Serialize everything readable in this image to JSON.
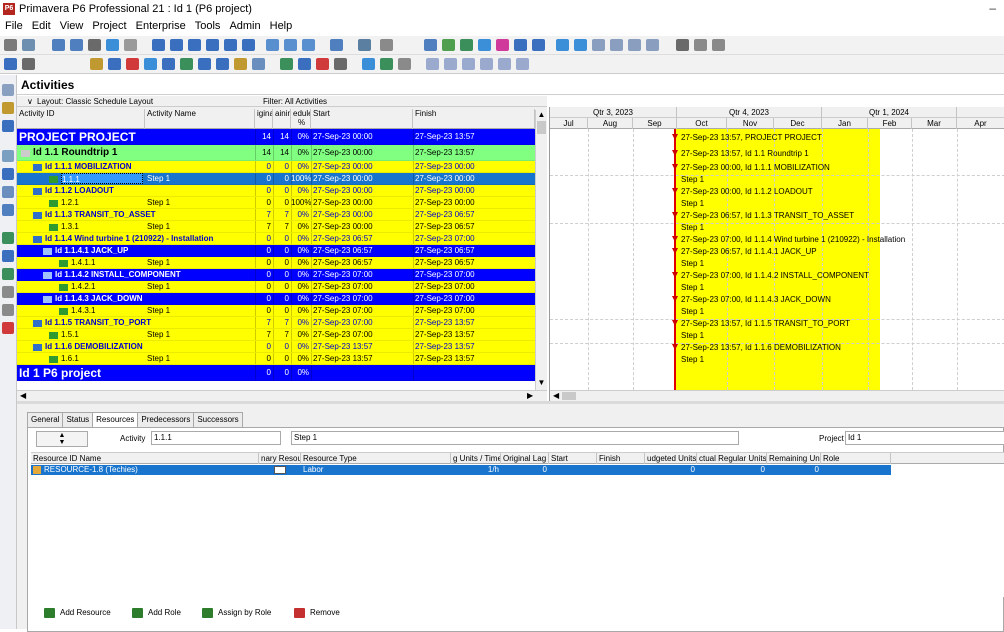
{
  "app": {
    "title": "Primavera P6 Professional 21 : Id 1 (P6 project)",
    "icon_text": "P6",
    "minimize_glyph": "–"
  },
  "menu": [
    "File",
    "Edit",
    "View",
    "Project",
    "Enterprise",
    "Tools",
    "Admin",
    "Help"
  ],
  "panel_title": "Activities",
  "layout_label": "Layout: Classic Schedule Layout",
  "filter_label": "Filter: All Activities",
  "columns": {
    "id": "Activity ID",
    "name": "Activity Name",
    "orig": "iginal",
    "rem": "aining",
    "sched_1": "edule",
    "sched_2": "%",
    "start": "Start",
    "finish": "Finish"
  },
  "rows": [
    {
      "kind": "project",
      "id": "PROJECT  PROJECT",
      "name": "",
      "orig": "14",
      "rem": "14",
      "pct": "0%",
      "start": "27-Sep-23 00:00",
      "finish": "27-Sep-23 13:57"
    },
    {
      "kind": "l1",
      "id": "Id 1.1  Roundtrip 1",
      "name": "",
      "orig": "14",
      "rem": "14",
      "pct": "0%",
      "start": "27-Sep-23 00:00",
      "finish": "27-Sep-23 13:57"
    },
    {
      "kind": "wbs",
      "id": "Id 1.1.1  MOBILIZATION",
      "name": "",
      "orig": "0",
      "rem": "0",
      "pct": "0%",
      "start": "27-Sep-23 00:00",
      "finish": "27-Sep-23 00:00"
    },
    {
      "kind": "sel",
      "id": "1.1.1",
      "name": "Step 1",
      "orig": "0",
      "rem": "0",
      "pct": "100%",
      "start": "27-Sep-23 00:00",
      "finish": "27-Sep-23 00:00"
    },
    {
      "kind": "wbs",
      "id": "Id 1.1.2  LOADOUT",
      "name": "",
      "orig": "0",
      "rem": "0",
      "pct": "0%",
      "start": "27-Sep-23 00:00",
      "finish": "27-Sep-23 00:00"
    },
    {
      "kind": "act",
      "id": "1.2.1",
      "name": "Step 1",
      "orig": "0",
      "rem": "0",
      "pct": "100%",
      "start": "27-Sep-23 00:00",
      "finish": "27-Sep-23 00:00"
    },
    {
      "kind": "wbs",
      "id": "Id 1.1.3  TRANSIT_TO_ASSET",
      "name": "",
      "orig": "7",
      "rem": "7",
      "pct": "0%",
      "start": "27-Sep-23 00:00",
      "finish": "27-Sep-23 06:57"
    },
    {
      "kind": "act",
      "id": "1.3.1",
      "name": "Step 1",
      "orig": "7",
      "rem": "7",
      "pct": "0%",
      "start": "27-Sep-23 00:00",
      "finish": "27-Sep-23 06:57"
    },
    {
      "kind": "wbs",
      "id": "Id 1.1.4  Wind turbine 1 (210922) - Installation",
      "name": "",
      "orig": "0",
      "rem": "0",
      "pct": "0%",
      "start": "27-Sep-23 06:57",
      "finish": "27-Sep-23 07:00"
    },
    {
      "kind": "sub",
      "id": "Id 1.1.4.1  JACK_UP",
      "name": "",
      "orig": "0",
      "rem": "0",
      "pct": "0%",
      "start": "27-Sep-23 06:57",
      "finish": "27-Sep-23 06:57"
    },
    {
      "kind": "act2",
      "id": "1.4.1.1",
      "name": "Step 1",
      "orig": "0",
      "rem": "0",
      "pct": "0%",
      "start": "27-Sep-23 06:57",
      "finish": "27-Sep-23 06:57"
    },
    {
      "kind": "sub",
      "id": "Id 1.1.4.2  INSTALL_COMPONENT",
      "name": "",
      "orig": "0",
      "rem": "0",
      "pct": "0%",
      "start": "27-Sep-23 07:00",
      "finish": "27-Sep-23 07:00"
    },
    {
      "kind": "act2",
      "id": "1.4.2.1",
      "name": "Step 1",
      "orig": "0",
      "rem": "0",
      "pct": "0%",
      "start": "27-Sep-23 07:00",
      "finish": "27-Sep-23 07:00"
    },
    {
      "kind": "sub",
      "id": "Id 1.1.4.3  JACK_DOWN",
      "name": "",
      "orig": "0",
      "rem": "0",
      "pct": "0%",
      "start": "27-Sep-23 07:00",
      "finish": "27-Sep-23 07:00"
    },
    {
      "kind": "act2",
      "id": "1.4.3.1",
      "name": "Step 1",
      "orig": "0",
      "rem": "0",
      "pct": "0%",
      "start": "27-Sep-23 07:00",
      "finish": "27-Sep-23 07:00"
    },
    {
      "kind": "wbs",
      "id": "Id 1.1.5  TRANSIT_TO_PORT",
      "name": "",
      "orig": "7",
      "rem": "7",
      "pct": "0%",
      "start": "27-Sep-23 07:00",
      "finish": "27-Sep-23 13:57"
    },
    {
      "kind": "act",
      "id": "1.5.1",
      "name": "Step 1",
      "orig": "7",
      "rem": "7",
      "pct": "0%",
      "start": "27-Sep-23 07:00",
      "finish": "27-Sep-23 13:57"
    },
    {
      "kind": "wbs",
      "id": "Id 1.1.6  DEMOBILIZATION",
      "name": "",
      "orig": "0",
      "rem": "0",
      "pct": "0%",
      "start": "27-Sep-23 13:57",
      "finish": "27-Sep-23 13:57"
    },
    {
      "kind": "act",
      "id": "1.6.1",
      "name": "Step 1",
      "orig": "0",
      "rem": "0",
      "pct": "0%",
      "start": "27-Sep-23 13:57",
      "finish": "27-Sep-23 13:57"
    },
    {
      "kind": "project",
      "id": "Id 1  P6 project",
      "name": "",
      "orig": "0",
      "rem": "0",
      "pct": "0%",
      "start": "",
      "finish": ""
    }
  ],
  "timeline": {
    "quarters": [
      "Qtr 3, 2023",
      "Qtr 4, 2023",
      "Qtr 1, 2024"
    ],
    "months": [
      "Jul",
      "Aug",
      "Sep",
      "Oct",
      "Nov",
      "Dec",
      "Jan",
      "Feb",
      "Mar",
      "Apr"
    ]
  },
  "gantt_labels": [
    "27-Sep-23 13:57, PROJECT  PROJECT",
    "27-Sep-23 13:57, Id 1.1  Roundtrip 1",
    "27-Sep-23 00:00, Id 1.1.1  MOBILIZATION",
    "Step 1",
    "27-Sep-23 00:00, Id 1.1.2  LOADOUT",
    "Step 1",
    "27-Sep-23 06:57, Id 1.1.3  TRANSIT_TO_ASSET",
    "Step 1",
    "27-Sep-23 07:00, Id 1.1.4  Wind turbine 1 (210922) - Installation",
    "27-Sep-23 06:57, Id 1.1.4.1  JACK_UP",
    "Step 1",
    "27-Sep-23 07:00, Id 1.1.4.2  INSTALL_COMPONENT",
    "Step 1",
    "27-Sep-23 07:00, Id 1.1.4.3  JACK_DOWN",
    "Step 1",
    "27-Sep-23 13:57, Id 1.1.5  TRANSIT_TO_PORT",
    "Step 1",
    "27-Sep-23 13:57, Id 1.1.6  DEMOBILIZATION",
    "Step 1"
  ],
  "tabs": [
    "General",
    "Status",
    "Resources",
    "Predecessors",
    "Successors"
  ],
  "active_tab": "Resources",
  "detail": {
    "activity_label": "Activity",
    "activity_value": "1.1.1",
    "activity_name": "Step 1",
    "project_label": "Project",
    "project_value": "Id 1"
  },
  "resource_columns": [
    "Resource ID Name",
    "nary Resou",
    "Resource Type",
    "g Units / Time",
    "Original Lag",
    "Start",
    "Finish",
    "udgeted Units",
    "ctual Regular Units",
    "Remaining Units",
    "Role"
  ],
  "resource_rows": [
    {
      "name": "RESOURCE-1.8 (Techies)",
      "type": "Labor",
      "units": "1/h",
      "lag": "0",
      "start": "",
      "finish": "",
      "budgeted": "0",
      "actual": "0",
      "remaining": "0",
      "role": ""
    }
  ],
  "buttons": {
    "add_resource": "Add Resource",
    "add_role": "Add Role",
    "assign_by_role": "Assign by Role",
    "remove": "Remove"
  },
  "glyphs": {
    "scroll_up": "▲",
    "scroll_down": "▼",
    "scroll_left": "◀",
    "scroll_right": "▶",
    "collapse": "∨"
  },
  "colors": {
    "project_row": "#0000ff",
    "l1_row": "#80ff80",
    "wbs_row": "#ffff00",
    "sub_row": "#0000ff",
    "selected": "#1874cd",
    "gantt_highlight": "#ffff00",
    "data_date_line": "#e00000"
  }
}
